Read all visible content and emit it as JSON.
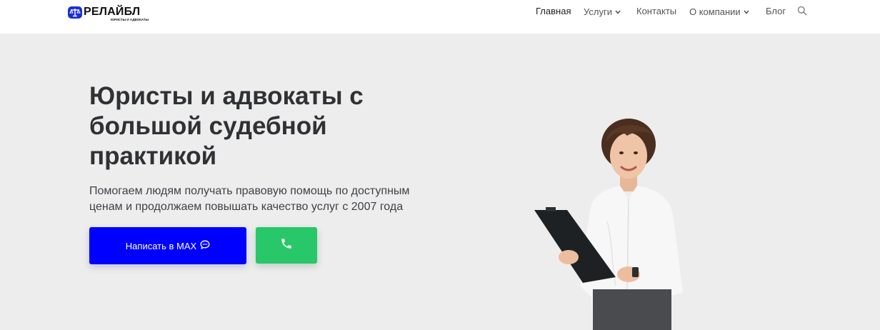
{
  "header": {
    "logo": {
      "name": "РЕЛАЙБЛ",
      "tagline": "юристы и адвокаты"
    },
    "nav": [
      {
        "label": "Главная",
        "active": true,
        "has_dropdown": false
      },
      {
        "label": "Услуги",
        "active": false,
        "has_dropdown": true
      },
      {
        "label": "Контакты",
        "active": false,
        "has_dropdown": false
      },
      {
        "label": "О компании",
        "active": false,
        "has_dropdown": true
      },
      {
        "label": "Блог",
        "active": false,
        "has_dropdown": false
      }
    ],
    "search_icon": "search-icon"
  },
  "hero": {
    "title": "Юристы и адвокаты с большой судебной практикой",
    "subtitle": "Помогаем людям получать правовую помощь по доступным ценам и продолжаем повышать качество услуг с 2007 года",
    "primary_button": {
      "label": "Написать в MAX",
      "icon": "chat-bubble-icon",
      "color": "#0000ff"
    },
    "call_button": {
      "icon": "phone-icon",
      "color": "#28c76a"
    }
  },
  "colors": {
    "background": "#ededed",
    "header": "#ffffff",
    "brand": "#1a2fd6"
  }
}
